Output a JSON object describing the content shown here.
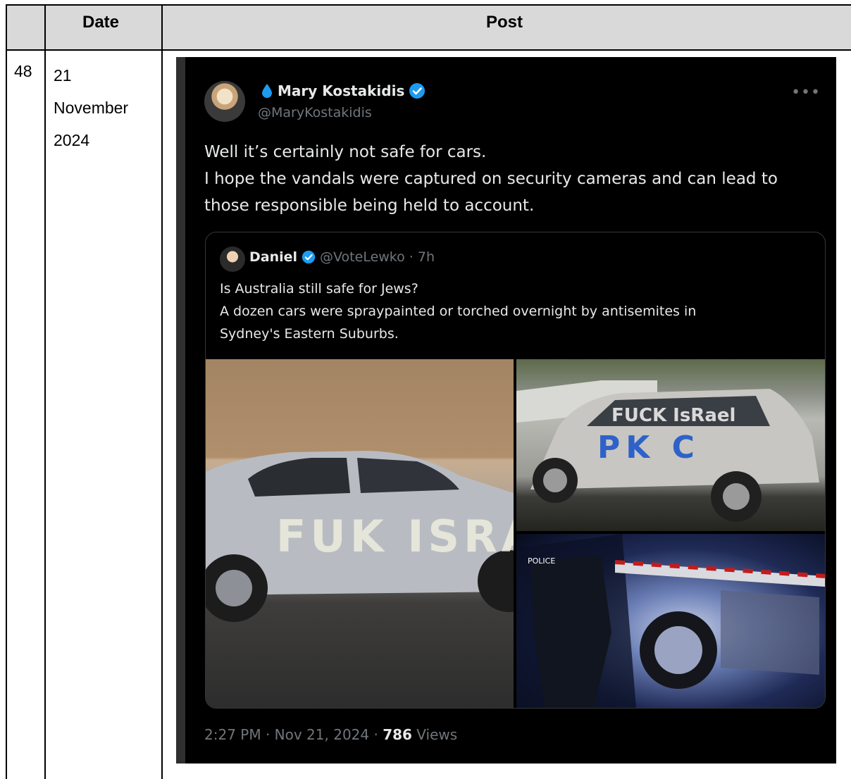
{
  "table": {
    "headers": {
      "num": "",
      "date": "Date",
      "post": "Post"
    },
    "row": {
      "num": "48",
      "date_lines": [
        "21",
        "November",
        "2024"
      ]
    }
  },
  "tweet": {
    "author_name": "Mary Kostakidis",
    "author_handle": "@MaryKostakidis",
    "more_icon": "more-dots-icon",
    "body_lines": [
      "Well it’s certainly not safe for cars.",
      "I hope the vandals were captured on security cameras and can lead to",
      "those responsible being held to account."
    ],
    "quote": {
      "name": "Daniel",
      "meta": "@VoteLewko · 7h",
      "text_lines": [
        "Is Australia still safe for Jews?",
        "A dozen cars were spraypainted or torched overnight by antisemites in",
        "Sydney's Eastern Suburbs."
      ],
      "images": {
        "img1_graffiti": "FUK ISRA",
        "img2_graffiti_top": "FUCK IsRael",
        "img2_graffiti_bottom": "PK C",
        "img3_police": "POLICE"
      }
    },
    "timestamp": {
      "time_date": "2:27 PM · Nov 21, 2024 · ",
      "views_count": "786",
      "views_label": " Views"
    },
    "colors": {
      "background": "#000000",
      "text": "#e7e9ea",
      "muted": "#71767b",
      "verified": "#1d9bf0",
      "border": "#333639"
    }
  }
}
